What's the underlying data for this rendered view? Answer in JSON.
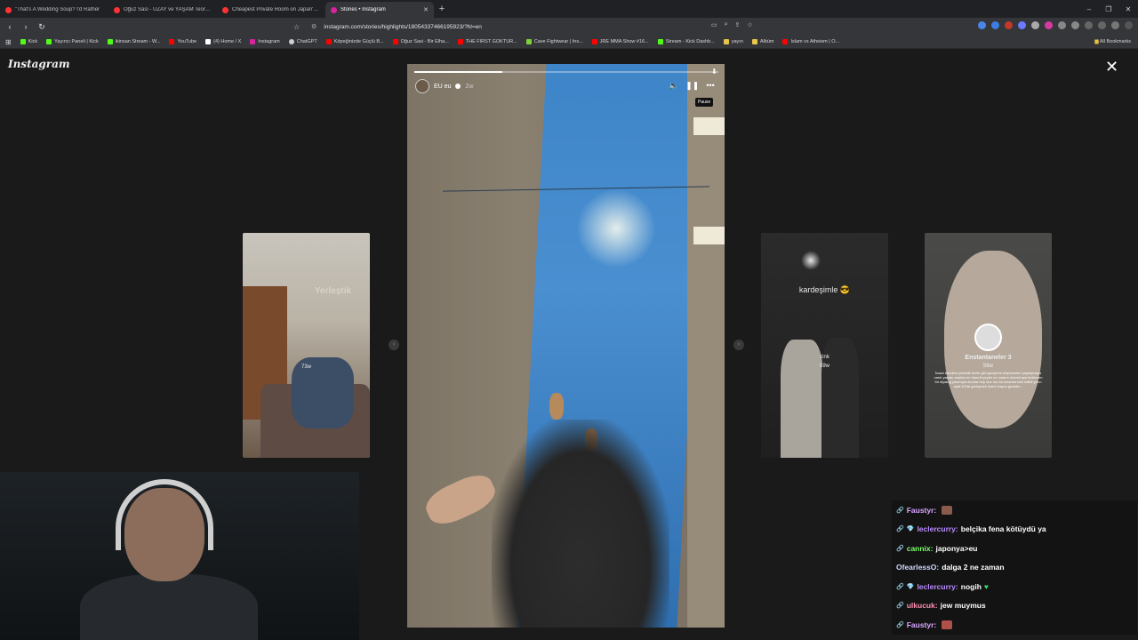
{
  "tabs": [
    {
      "title": "\"That's A Wedding Soup? I'd Rather",
      "color": "#ff3333"
    },
    {
      "title": "Oğuz Sasi - UZAY ve YAŞAM Teorileri",
      "color": "#ff3333"
    },
    {
      "title": "Cheapest Private Room on Japan's C",
      "color": "#ff3333"
    },
    {
      "title": "Stories • Instagram",
      "color": "#d6249f",
      "active": true
    }
  ],
  "new_tab": "+",
  "window_controls": [
    "–",
    "❐",
    "✕"
  ],
  "address": {
    "url": "instagram.com/stories/highlights/18054337466195923/?hl=en"
  },
  "bookmarks": [
    {
      "label": "Kick",
      "color": "#53fc18"
    },
    {
      "label": "Yayıncı Paneli | Kick",
      "color": "#53fc18"
    },
    {
      "label": "ikinsan Stream - W...",
      "color": "#53fc18"
    },
    {
      "label": "YouTube",
      "color": "#ff0000"
    },
    {
      "label": "(4) Home / X",
      "color": "#ffffff"
    },
    {
      "label": "Instagram",
      "color": "#d6249f"
    },
    {
      "label": "ChatGPT",
      "color": "#cfcfcf"
    },
    {
      "label": "Köpeğinizde Güçlü B...",
      "color": "#ff0000"
    },
    {
      "label": "Oğuz Sasi - Bir Elha...",
      "color": "#ff0000"
    },
    {
      "label": "THE FIRST GOKTUR...",
      "color": "#ff0000"
    },
    {
      "label": "Cave Fightwear | Ins...",
      "color": "#7ccf3c"
    },
    {
      "label": "JRE MMA Show #16...",
      "color": "#ff0000"
    },
    {
      "label": "Stream - Kick Dashb...",
      "color": "#53fc18"
    },
    {
      "label": "yayın",
      "color": "#e8c44a"
    },
    {
      "label": "Albüm",
      "color": "#e8c44a"
    },
    {
      "label": "Islam vs Atheism | O...",
      "color": "#ff0000"
    }
  ],
  "all_bookmarks": "All Bookmarks",
  "instagram_logo": "Instagram",
  "story": {
    "username": "EU eu",
    "time": "2w",
    "tooltip": "Pause",
    "progress": 0.29
  },
  "thumbs": {
    "left": {
      "caption": "Yerleştik",
      "sub": "73w"
    },
    "right1": {
      "caption": "kardeşimle 😎",
      "name": "zink",
      "sub": "59w"
    },
    "right2": {
      "name": "Enstantaneler 3",
      "sub": "56w",
      "text": "İnsan kendine yetebilir bizim gibi gençlerin düşünceleri paylaşmaya vardı yaşam aradan en önemli şeyler ve onların önemli şey beklenen bir diyalog yazmışlar bunlar hep olur mu bu insanlar fark edildi yarın saat 10'da görüşmek üzere hayırlı geceler..."
    }
  },
  "chat": [
    {
      "user": "Faustyr:",
      "user_color": "#d7a6ff",
      "msg": "",
      "emote": "#8a5a4a"
    },
    {
      "user": "leclercurry:",
      "user_color": "#b98bff",
      "msg": "belçika fena kötüydü ya",
      "badge": "💎"
    },
    {
      "user": "cannix:",
      "user_color": "#7cff6b",
      "msg": "japonya>eu"
    },
    {
      "user": "OfearlessO:",
      "user_color": "#cfd8ff",
      "msg": "dalga 2 ne zaman"
    },
    {
      "user": "leclercurry:",
      "user_color": "#b98bff",
      "msg": "nogih",
      "badge": "💎",
      "emote": "#3cd86b"
    },
    {
      "user": "ulkucuk:",
      "user_color": "#ff8fb1",
      "msg": "jew muymus"
    },
    {
      "user": "Faustyr:",
      "user_color": "#d7a6ff",
      "msg": "",
      "emote": "#b0504a"
    }
  ]
}
